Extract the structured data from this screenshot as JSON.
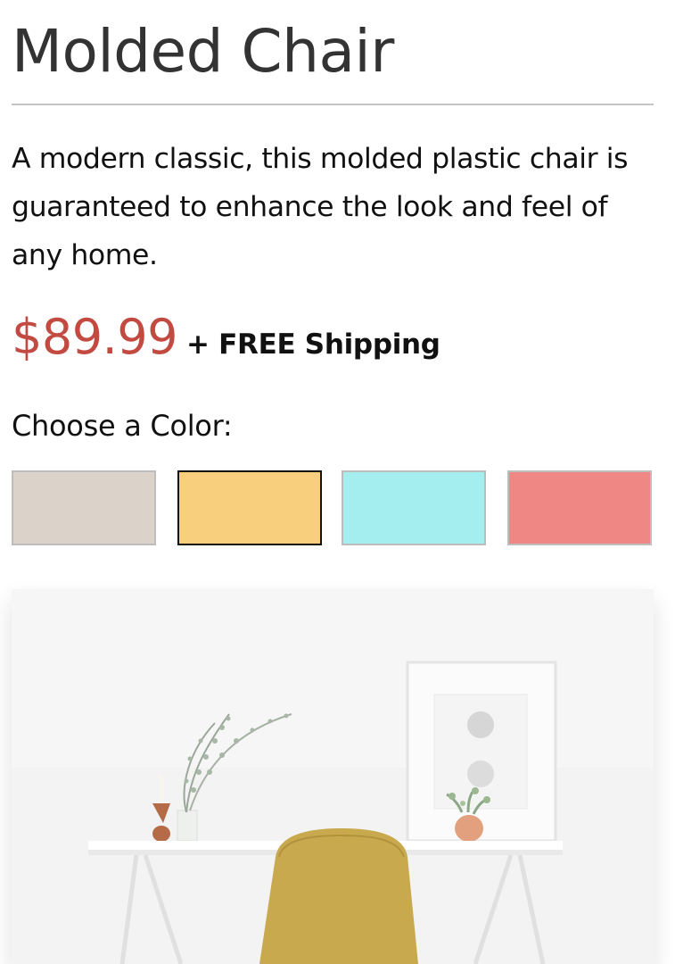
{
  "product": {
    "title": "Molded Chair",
    "description": "A modern classic, this molded plastic chair is guaranteed to enhance the look and feel of any home.",
    "price": "$89.99",
    "shipping": "+ FREE Shipping",
    "price_color": "#c24a40"
  },
  "color_picker": {
    "label": "Choose a Color:",
    "selected_index": 1,
    "options": [
      {
        "name": "beige",
        "hex": "#dbd3ca"
      },
      {
        "name": "yellow",
        "hex": "#f8cf7c"
      },
      {
        "name": "aqua",
        "hex": "#a5eef0"
      },
      {
        "name": "coral",
        "hex": "#ef8884"
      }
    ]
  },
  "photo": {
    "subject": "yellow molded chair at white desk"
  }
}
